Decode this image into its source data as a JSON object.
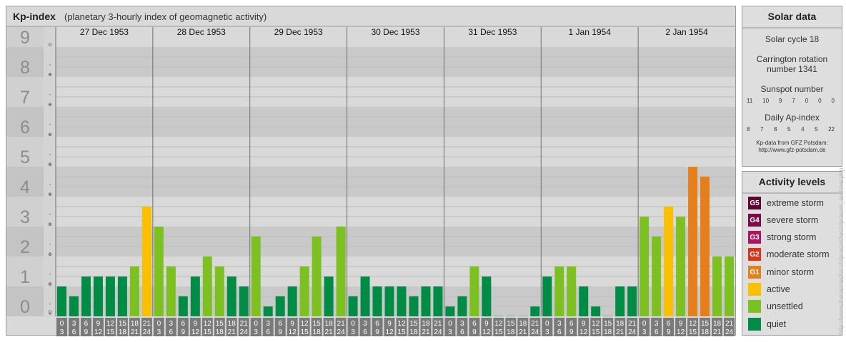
{
  "header": {
    "title": "Kp-index",
    "subtitle": "(planetary 3-hourly index of geomagnetic activity)"
  },
  "solar_data": {
    "title": "Solar data",
    "solar_cycle": "Solar cycle 18",
    "carrington_line1": "Carrington rotation",
    "carrington_line2": "number 1341",
    "sunspot_label": "Sunspot number",
    "sunspot_values": [
      "11",
      "10",
      "9",
      "7",
      "0",
      "0",
      "0"
    ],
    "ap_label": "Daily Ap-index",
    "ap_values": [
      "8",
      "7",
      "8",
      "5",
      "4",
      "5",
      "22"
    ],
    "source_line1": "Kp-data from GFZ Potsdam:",
    "source_line2": "http://www.gfz-potsdam.de"
  },
  "activity_levels": {
    "title": "Activity levels",
    "items": [
      {
        "code": "G5",
        "label": "extreme storm",
        "color": "#5c0730"
      },
      {
        "code": "G4",
        "label": "severe storm",
        "color": "#7a0a49"
      },
      {
        "code": "G3",
        "label": "strong storm",
        "color": "#ae1261"
      },
      {
        "code": "G2",
        "label": "moderate storm",
        "color": "#d6341b"
      },
      {
        "code": "G1",
        "label": "minor storm",
        "color": "#e67e1a"
      },
      {
        "code": "",
        "label": "active",
        "color": "#f9c000"
      },
      {
        "code": "",
        "label": "unsettled",
        "color": "#7dc022"
      },
      {
        "code": "",
        "label": "quiet",
        "color": "#008c45"
      }
    ]
  },
  "credit": "http://www.theusinesfur.ch/pracvir/tech/pracvir_archive.php",
  "chart_data": {
    "type": "bar",
    "y_major_labels": [
      "0",
      "1",
      "2",
      "3",
      "4",
      "5",
      "6",
      "7",
      "8",
      "9"
    ],
    "y_minor_labels": [
      "-",
      "o",
      "+"
    ],
    "ylim": [
      0,
      9.33
    ],
    "days": [
      "27 Dec 1953",
      "28 Dec 1953",
      "29 Dec 1953",
      "30 Dec 1953",
      "31 Dec 1953",
      "1 Jan 1954",
      "2 Jan 1954"
    ],
    "hour_top": [
      "0",
      "3",
      "6",
      "9",
      "12",
      "15",
      "18",
      "21"
    ],
    "hour_bottom": [
      "3",
      "6",
      "9",
      "12",
      "15",
      "18",
      "21",
      "24"
    ],
    "values": [
      [
        1.0,
        0.67,
        1.33,
        1.33,
        1.33,
        1.33,
        1.67,
        3.67
      ],
      [
        3.0,
        1.67,
        0.67,
        1.33,
        2.0,
        1.67,
        1.33,
        1.0
      ],
      [
        2.67,
        0.33,
        0.67,
        1.0,
        1.67,
        2.67,
        1.33,
        3.0
      ],
      [
        0.67,
        1.33,
        1.0,
        1.0,
        1.0,
        0.67,
        1.0,
        1.0
      ],
      [
        0.33,
        0.67,
        1.67,
        1.33,
        0.0,
        0.0,
        0.0,
        0.33
      ],
      [
        1.33,
        1.67,
        1.67,
        1.0,
        0.33,
        -0.33,
        1.0,
        1.0
      ],
      [
        3.33,
        2.67,
        3.67,
        3.33,
        5.0,
        4.67,
        2.0,
        2.0
      ]
    ],
    "color_scale": {
      "quiet": "#008c45",
      "unsettled": "#7dc022",
      "active": "#f9c000",
      "minor_storm": "#e67e1a",
      "moderate_storm": "#d6341b"
    }
  }
}
